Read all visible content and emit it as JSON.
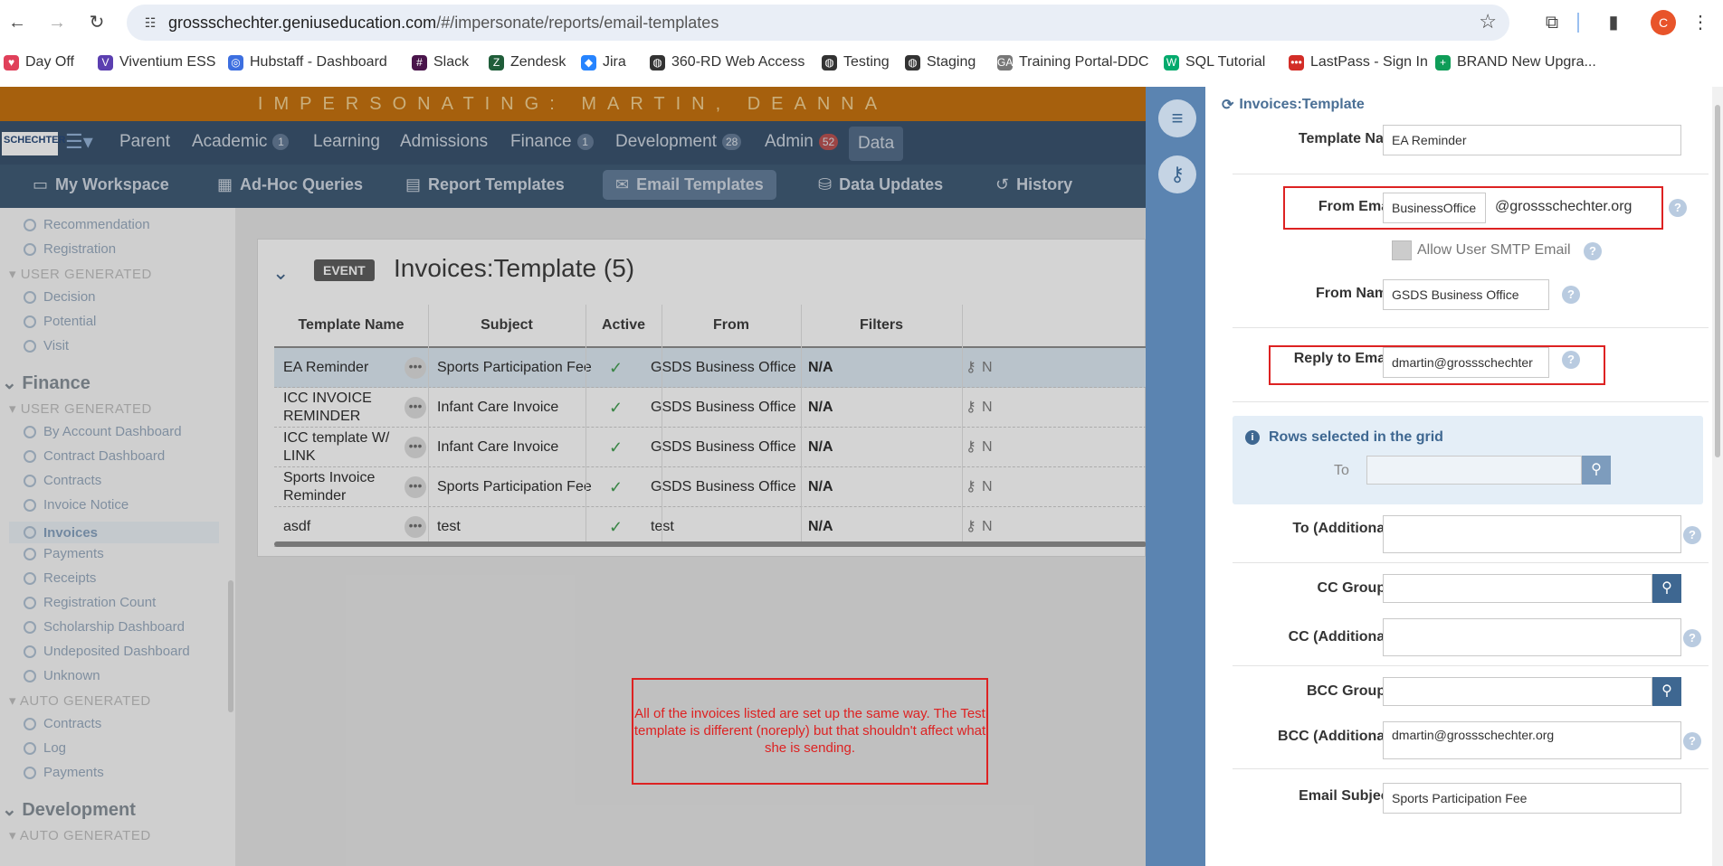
{
  "browser": {
    "url_host": "grossschechter.geniuseducation.com",
    "url_path": "/#/impersonate/reports/email-templates",
    "avatar_letter": "C"
  },
  "bookmarks": [
    {
      "label": "Day Off",
      "icon": "heart-icon",
      "color": "#e0405a"
    },
    {
      "label": "Viventium ESS",
      "icon": "v-logo-icon",
      "color": "#5b3fb0"
    },
    {
      "label": "Hubstaff - Dashboard",
      "icon": "hubstaff-icon",
      "color": "#3d6fe0"
    },
    {
      "label": "Slack",
      "icon": "slack-icon",
      "color": "#4a154b"
    },
    {
      "label": "Zendesk",
      "icon": "zendesk-icon",
      "color": "#1f5d39"
    },
    {
      "label": "Jira",
      "icon": "jira-icon",
      "color": "#2684ff"
    },
    {
      "label": "360-RD Web Access",
      "icon": "globe-icon",
      "color": "#333"
    },
    {
      "label": "Testing",
      "icon": "globe-icon",
      "color": "#333"
    },
    {
      "label": "Staging",
      "icon": "globe-icon",
      "color": "#333"
    },
    {
      "label": "Training Portal-DDC",
      "icon": "ga-icon",
      "color": "#777"
    },
    {
      "label": "SQL Tutorial",
      "icon": "w3-icon",
      "color": "#04aa6d"
    },
    {
      "label": "LastPass - Sign In",
      "icon": "lastpass-icon",
      "color": "#d32d27"
    },
    {
      "label": "BRAND New Upgra...",
      "icon": "sheets-icon",
      "color": "#0f9d58"
    }
  ],
  "impersonating": "IMPERSONATING: MARTIN, DEANNA",
  "logo": "SCHECHTER",
  "main_nav": [
    {
      "label": "Parent",
      "count": ""
    },
    {
      "label": "Academic",
      "count": "1"
    },
    {
      "label": "Learning",
      "count": ""
    },
    {
      "label": "Admissions",
      "count": ""
    },
    {
      "label": "Finance",
      "count": "1"
    },
    {
      "label": "Development",
      "count": "28"
    },
    {
      "label": "Admin",
      "count": "52"
    },
    {
      "label": "Data",
      "count": ""
    }
  ],
  "sub_nav": [
    {
      "label": "My Workspace",
      "icon": "folder-icon"
    },
    {
      "label": "Ad-Hoc Queries",
      "icon": "grid-icon"
    },
    {
      "label": "Report Templates",
      "icon": "document-icon"
    },
    {
      "label": "Email Templates",
      "icon": "email-icon"
    },
    {
      "label": "Data Updates",
      "icon": "database-icon"
    },
    {
      "label": "History",
      "icon": "history-icon"
    }
  ],
  "sidebar": {
    "items_top": [
      "Recommendation",
      "Registration"
    ],
    "user_generated_1": "USER GENERATED",
    "ug1_items": [
      "Decision",
      "Potential",
      "Visit"
    ],
    "finance": "Finance",
    "user_generated_2": "USER GENERATED",
    "finance_items": [
      "By Account Dashboard",
      "Contract Dashboard",
      "Contracts",
      "Invoice Notice",
      "Invoices",
      "Payments",
      "Receipts",
      "Registration Count",
      "Scholarship Dashboard",
      "Undeposited Dashboard",
      "Unknown"
    ],
    "auto_generated_1": "AUTO GENERATED",
    "auto_items": [
      "Contracts",
      "Log",
      "Payments"
    ],
    "development": "Development",
    "auto_generated_2": "AUTO GENERATED"
  },
  "card": {
    "badge": "EVENT",
    "title": "Invoices:Template (5)"
  },
  "table": {
    "headers": [
      "Template Name",
      "Subject",
      "Active",
      "From",
      "Filters"
    ],
    "rows": [
      {
        "name": "EA Reminder",
        "subject": "Sports Participation Fee",
        "from": "GSDS Business Office",
        "filters": "N/A",
        "tail": "N"
      },
      {
        "name": "ICC INVOICE REMINDER",
        "subject": "Infant Care Invoice",
        "from": "GSDS Business Office",
        "filters": "N/A",
        "tail": "N"
      },
      {
        "name": "ICC template W/ LINK",
        "subject": "Infant Care Invoice",
        "from": "GSDS Business Office",
        "filters": "N/A",
        "tail": "N"
      },
      {
        "name": "Sports Invoice Reminder",
        "subject": "Sports Participation Fee",
        "from": "GSDS Business Office",
        "filters": "N/A",
        "tail": "N"
      },
      {
        "name": "asdf",
        "subject": "test",
        "from": "test",
        "filters": "N/A",
        "tail": "N"
      }
    ]
  },
  "annotation": "All of the invoices listed are set up the same way. The Test template is different (noreply) but that shouldn't affect what she is sending.",
  "panel": {
    "title": "Invoices:Template",
    "template_name_label": "Template Name",
    "template_name": "EA Reminder",
    "from_email_label": "From Email",
    "from_email": "BusinessOffice",
    "from_domain": "@grossschechter.org",
    "allow_smtp_label": "Allow User SMTP Email",
    "from_name_label": "From Name",
    "from_name": "GSDS Business Office",
    "reply_label": "Reply to Email",
    "reply": "dmartin@grossschechter",
    "rows_selected": "Rows selected in the grid",
    "to_label": "To",
    "to_additional_label": "To (Additional)",
    "cc_groups_label": "CC Groups",
    "cc_additional_label": "CC (Additional)",
    "bcc_groups_label": "BCC Groups",
    "bcc_additional_label": "BCC (Additional)",
    "bcc_additional": "dmartin@grossschechter.org",
    "email_subject_label": "Email Subject",
    "email_subject": "Sports Participation Fee"
  }
}
